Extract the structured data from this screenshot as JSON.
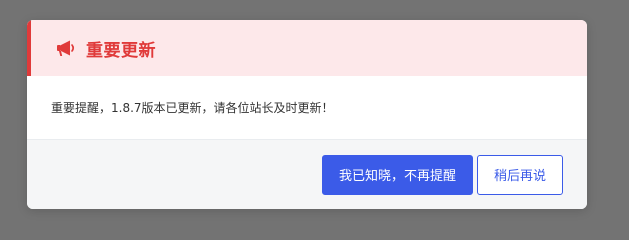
{
  "modal": {
    "title": "重要更新",
    "icon": "megaphone-icon",
    "message": "重要提醒，1.8.7版本已更新，请各位站长及时更新！",
    "buttons": {
      "primary_label": "我已知晓，不再提醒",
      "secondary_label": "稍后再说"
    }
  },
  "colors": {
    "accent_red": "#e03a3a",
    "header_bg": "#fde8ea",
    "primary_blue": "#3b5be8",
    "overlay": "#737373",
    "footer_bg": "#f5f6f7"
  }
}
